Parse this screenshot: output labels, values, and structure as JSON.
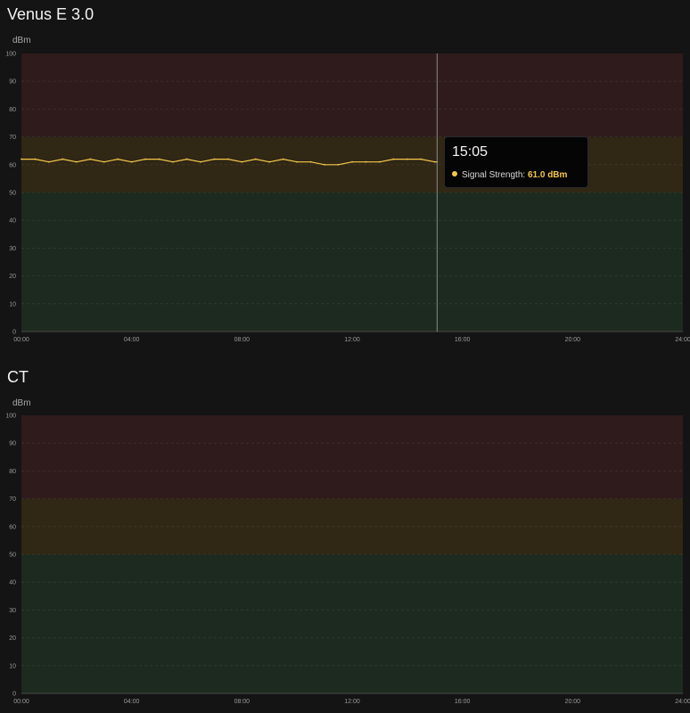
{
  "colors": {
    "background": "#141414",
    "zone_red": "#2f1b1c",
    "zone_yellow": "#302714",
    "zone_green": "#1c2a1f",
    "series": "#f5c74c",
    "cursor": "#8a8a8a"
  },
  "panels": [
    {
      "title": "Venus E 3.0",
      "unit": "dBm",
      "tooltip": {
        "time": "15:05",
        "label": "Signal Strength:",
        "value": "61.0 dBm"
      }
    },
    {
      "title": "CT",
      "unit": "dBm"
    }
  ],
  "chart_data": [
    {
      "type": "line",
      "title": "Venus E 3.0",
      "ylabel": "dBm",
      "xlim": [
        "00:00",
        "24:00"
      ],
      "ylim": [
        0,
        100
      ],
      "x_ticks": [
        "00:00",
        "04:00",
        "08:00",
        "12:00",
        "16:00",
        "20:00",
        "24:00"
      ],
      "y_ticks": [
        0,
        10,
        20,
        30,
        40,
        50,
        60,
        70,
        80,
        90,
        100
      ],
      "grid": true,
      "zones": [
        {
          "from": 70,
          "to": 100,
          "color": "red"
        },
        {
          "from": 50,
          "to": 70,
          "color": "yellow"
        },
        {
          "from": 0,
          "to": 50,
          "color": "green"
        }
      ],
      "cursor_x": "15:05",
      "series": [
        {
          "name": "Signal Strength",
          "color": "#f5c74c",
          "x": [
            "00:00",
            "00:30",
            "01:00",
            "01:30",
            "02:00",
            "02:30",
            "03:00",
            "03:30",
            "04:00",
            "04:30",
            "05:00",
            "05:30",
            "06:00",
            "06:30",
            "07:00",
            "07:30",
            "08:00",
            "08:30",
            "09:00",
            "09:30",
            "10:00",
            "10:30",
            "11:00",
            "11:30",
            "12:00",
            "12:30",
            "13:00",
            "13:30",
            "14:00",
            "14:30",
            "15:00",
            "15:05"
          ],
          "values": [
            62,
            62,
            61,
            62,
            61,
            62,
            61,
            62,
            61,
            62,
            62,
            61,
            62,
            61,
            62,
            62,
            61,
            62,
            61,
            62,
            61,
            61,
            60,
            60,
            61,
            61,
            61,
            62,
            62,
            62,
            61,
            61
          ]
        }
      ]
    },
    {
      "type": "line",
      "title": "CT",
      "ylabel": "dBm",
      "xlim": [
        "00:00",
        "24:00"
      ],
      "ylim": [
        0,
        100
      ],
      "x_ticks": [
        "00:00",
        "04:00",
        "08:00",
        "12:00",
        "16:00",
        "20:00",
        "24:00"
      ],
      "y_ticks": [
        0,
        10,
        20,
        30,
        40,
        50,
        60,
        70,
        80,
        90,
        100
      ],
      "grid": true,
      "zones": [
        {
          "from": 70,
          "to": 100,
          "color": "red"
        },
        {
          "from": 50,
          "to": 70,
          "color": "yellow"
        },
        {
          "from": 0,
          "to": 50,
          "color": "green"
        }
      ],
      "series": []
    }
  ]
}
